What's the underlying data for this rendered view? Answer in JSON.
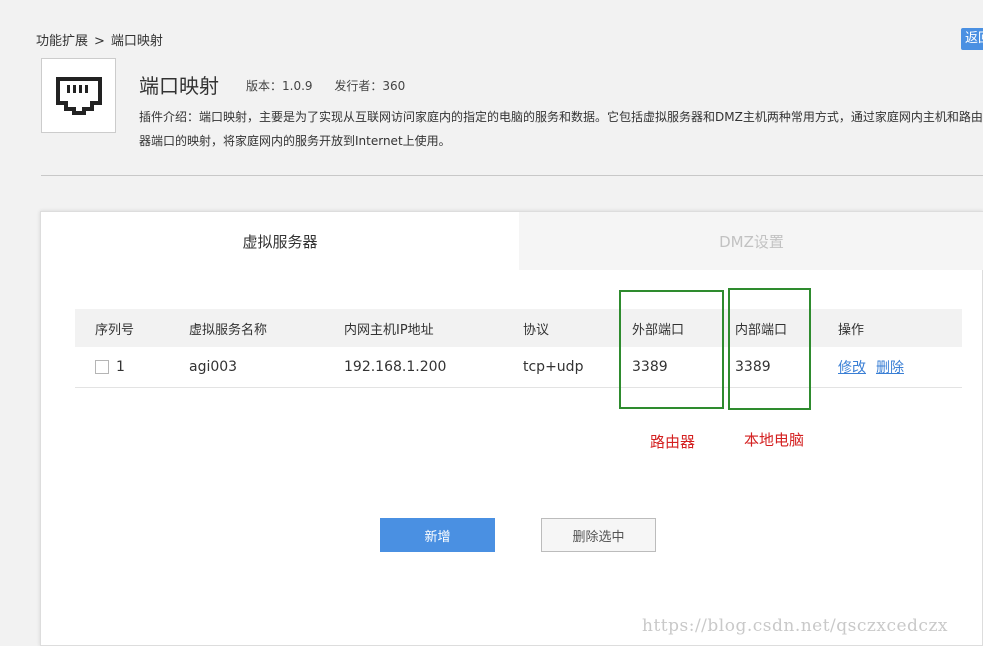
{
  "breadcrumb": {
    "parent": "功能扩展",
    "separator": ">",
    "current": "端口映射"
  },
  "header": {
    "return_label": "返回"
  },
  "plugin": {
    "icon": "ethernet-port-icon",
    "title": "端口映射",
    "version": "版本：1.0.9",
    "publisher": "发行者：360",
    "description": "插件介绍：端口映射，主要是为了实现从互联网访问家庭内的指定的电脑的服务和数据。它包括虚拟服务器和DMZ主机两种常用方式，通过家庭网内主机和路由器端口的映射，将家庭网内的服务开放到Internet上使用。"
  },
  "tabs": [
    {
      "label": "虚拟服务器",
      "active": true
    },
    {
      "label": "DMZ设置",
      "active": false
    }
  ],
  "table": {
    "headers": [
      "序列号",
      "虚拟服务名称",
      "内网主机IP地址",
      "协议",
      "外部端口",
      "内部端口",
      "操作"
    ],
    "rows": [
      {
        "index": "1",
        "name": "agi003",
        "ip": "192.168.1.200",
        "protocol": "tcp+udp",
        "external_port": "3389",
        "internal_port": "3389",
        "edit_label": "修改",
        "delete_label": "删除"
      }
    ]
  },
  "annotations": {
    "router": "路由器",
    "local_pc": "本地电脑"
  },
  "buttons": {
    "add": "新增",
    "delete_selected": "删除选中"
  },
  "watermark": "https://blog.csdn.net/qsczxcedczx",
  "colors": {
    "accent": "#4a90e2",
    "highlight_box": "#2e8b2e",
    "annotation_text": "#d42020",
    "link": "#3a7fd5"
  }
}
